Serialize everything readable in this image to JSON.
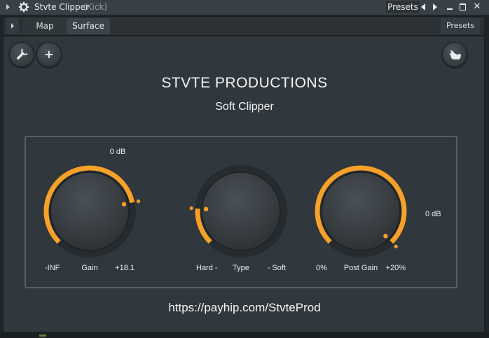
{
  "window": {
    "title": "Stvte Clipper",
    "subtitle": "(Kick)",
    "presets_label": "Presets",
    "close_glyph": "✕"
  },
  "tabs": [
    {
      "label": "Map",
      "selected": false
    },
    {
      "label": "Surface",
      "selected": true
    }
  ],
  "tabbar": {
    "presets_label": "Presets"
  },
  "toolbar": {
    "settings_icon": "wrench-icon",
    "add_icon": "plus-icon",
    "add_glyph": "+",
    "right_icon": "hand-icon"
  },
  "header": {
    "brand": "STVTE PRODUCTIONS",
    "product": "Soft Clipper"
  },
  "knobs": [
    {
      "name": "Gain",
      "value_text": "0 dB",
      "min_label": "-INF",
      "max_label": "+18.1",
      "value": 0.79
    },
    {
      "name": "Type",
      "value_text": "",
      "min_label": "Hard -",
      "max_label": "- Soft",
      "value": 0.18
    },
    {
      "name": "Post Gain",
      "value_text": "0 dB",
      "min_label": "0%",
      "max_label": "+20%",
      "value": 1.0
    }
  ],
  "footer": {
    "url": "https://payhip.com/StvteProd"
  },
  "colors": {
    "accent": "#f7a12a",
    "background": "#31383d",
    "knob_track": "#262b2f",
    "text": "#e8ecef"
  }
}
